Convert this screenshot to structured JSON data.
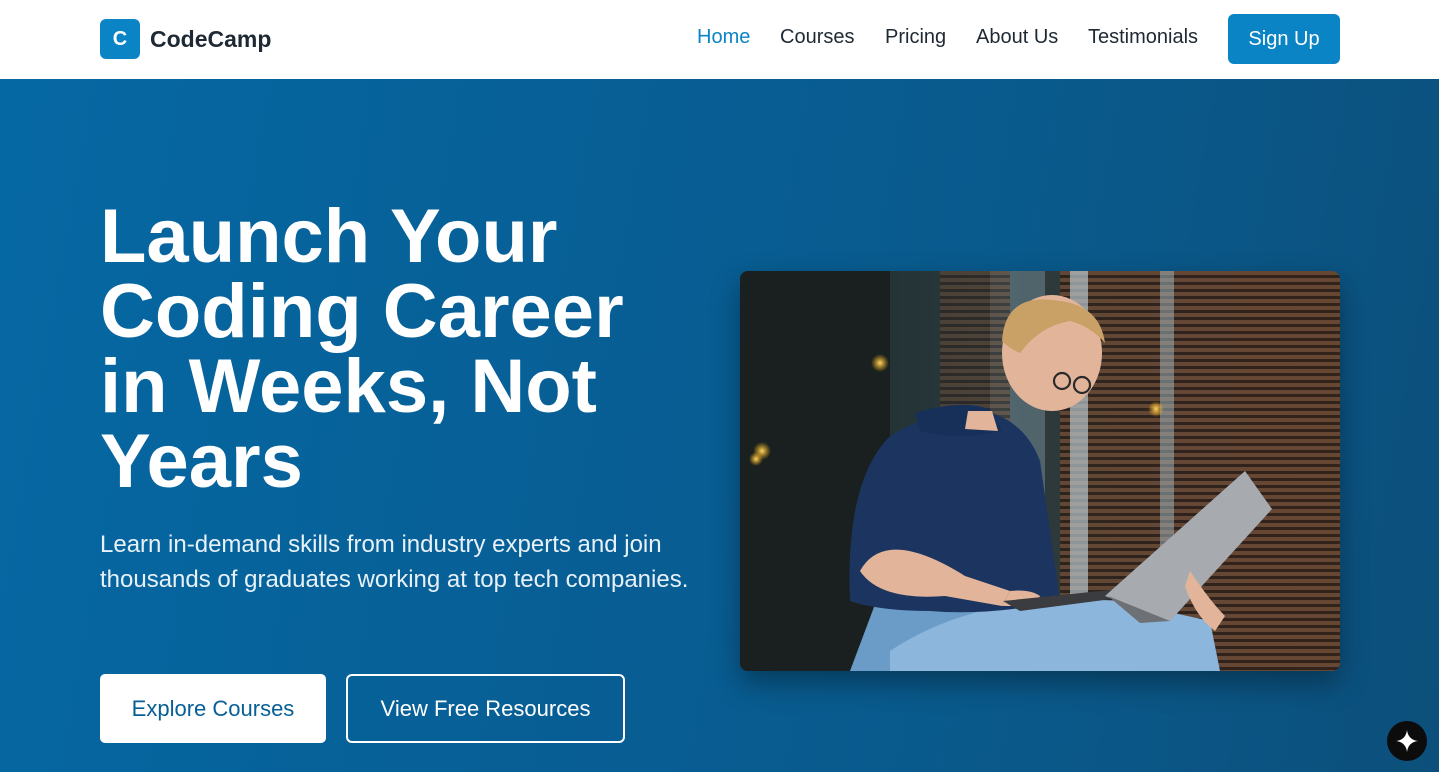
{
  "header": {
    "brand": {
      "mark": "C",
      "name": "CodeCamp"
    },
    "nav": [
      {
        "label": "Home",
        "active": true
      },
      {
        "label": "Courses",
        "active": false
      },
      {
        "label": "Pricing",
        "active": false
      },
      {
        "label": "About Us",
        "active": false
      },
      {
        "label": "Testimonials",
        "active": false
      }
    ],
    "cta": "Sign Up"
  },
  "hero": {
    "title": "Launch Your Coding Career in Weeks, Not Years",
    "subtitle": "Learn in-demand skills from industry experts and join thousands of graduates working at top tech companies.",
    "primary_button": "Explore Courses",
    "secondary_button": "View Free Resources",
    "image": {
      "icon": "student-with-laptop-photo"
    }
  },
  "floating": {
    "icon": "sparkle-icon"
  },
  "colors": {
    "brand": "#0b84c6",
    "hero_bg": "#075f96",
    "text_dark": "#1f2933",
    "white": "#ffffff"
  }
}
